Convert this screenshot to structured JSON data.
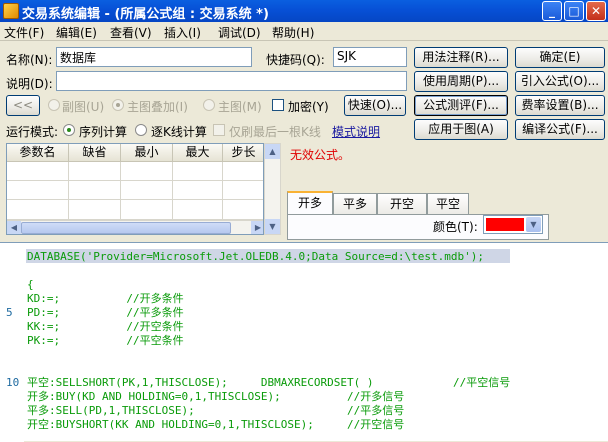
{
  "window": {
    "title": "交易系统编辑 - (所属公式组 : 交易系统 *)"
  },
  "menu": [
    "文件(F)",
    "编辑(E)",
    "查看(V)",
    "插入(I)",
    "调试(D)",
    "帮助(H)"
  ],
  "form": {
    "name_label": "名称(N):",
    "name_value": "数据库",
    "shortcut_label": "快捷码(Q):",
    "shortcut_value": "SJK",
    "desc_label": "说明(D):",
    "desc_value": ""
  },
  "buttons": {
    "usage_note": "用法注释(R)...",
    "ok": "确定(E)",
    "period": "使用周期(P)...",
    "import": "引入公式(O)...",
    "quick": "快速(O)...",
    "evaluate": "公式测评(F)...",
    "fee": "费率设置(B)...",
    "apply": "应用于图(A)",
    "compile": "编译公式(F)..."
  },
  "chart_opts": {
    "prev": "<<",
    "subchart": "副图(U)",
    "main_overlay": "主图叠加(I)",
    "main": "主图(M)",
    "encrypt": "加密(Y)"
  },
  "run_mode": {
    "label": "运行模式:",
    "sequential": "序列计算",
    "bar_by_bar": "逐K线计算",
    "refresh_last": "仅刷最后一根K线",
    "mode_help": "模式说明"
  },
  "params": {
    "headers": [
      "参数名",
      "缺省",
      "最小",
      "最大",
      "步长"
    ]
  },
  "status": {
    "error": "无效公式。",
    "error_color": "#e00000"
  },
  "signal_tabs": [
    "开多",
    "平多",
    "开空",
    "平空"
  ],
  "color_label": "颜色(T):",
  "color_value": "#ff0000",
  "editor": {
    "lines": [
      {
        "n": "",
        "t": "DATABASE('Provider=Microsoft.Jet.OLEDB.4.0;Data Source=d:\\test.mdb');"
      },
      {
        "n": "",
        "t": ""
      },
      {
        "n": "",
        "t": "{"
      },
      {
        "n": "",
        "t": "KD:=;          //开多条件"
      },
      {
        "n": "5",
        "t": "PD:=;          //平多条件"
      },
      {
        "n": "",
        "t": "KK:=;          //开空条件"
      },
      {
        "n": "",
        "t": "PK:=;          //平空条件"
      },
      {
        "n": "",
        "t": ""
      },
      {
        "n": "",
        "t": ""
      },
      {
        "n": "10",
        "t": "平空:SELLSHORT(PK,1,THISCLOSE);     DBMAXRECORDSET( )            //平空信号"
      },
      {
        "n": "",
        "t": "开多:BUY(KD AND HOLDING=0,1,THISCLOSE);          //开多信号"
      },
      {
        "n": "",
        "t": "平多:SELL(PD,1,THISCLOSE);                       //平多信号"
      },
      {
        "n": "",
        "t": "开空:BUYSHORT(KK AND HOLDING=0,1,THISCLOSE);     //开空信号"
      }
    ]
  }
}
